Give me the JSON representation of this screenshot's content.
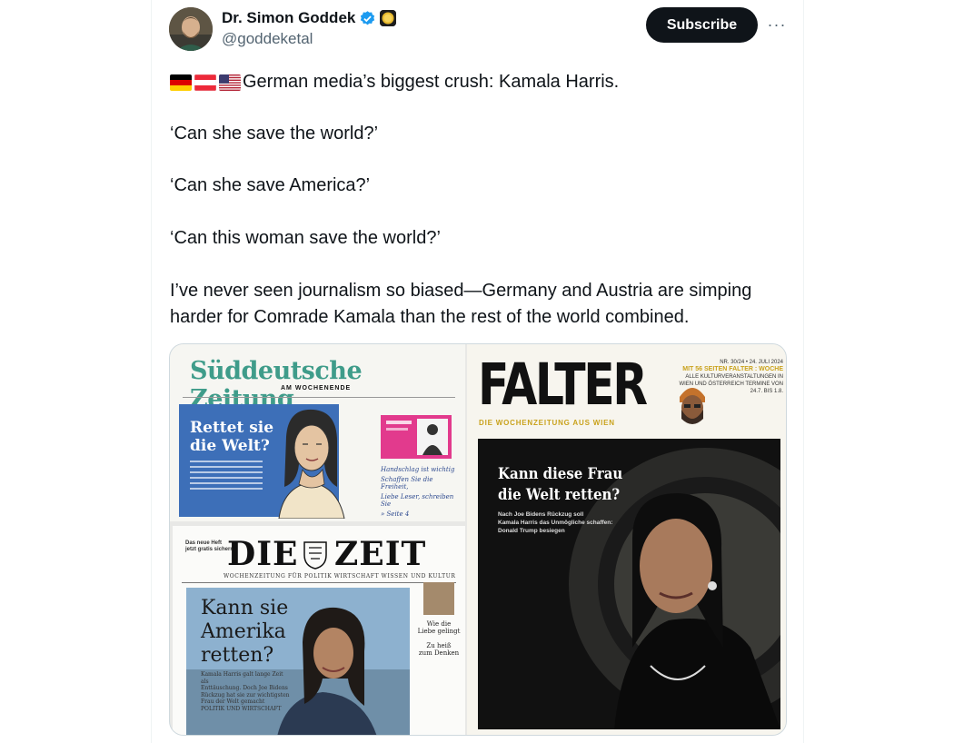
{
  "author": {
    "display_name": "Dr. Simon Goddek",
    "handle": "@goddeketal",
    "verified_icon": "verified-badge-icon",
    "affiliate_icon": "gold-circle-badge-icon"
  },
  "actions": {
    "subscribe_label": "Subscribe",
    "more_label": "···"
  },
  "tweet": {
    "flags": [
      "germany-flag-icon",
      "austria-flag-icon",
      "usa-flag-icon"
    ],
    "line1": "German media’s biggest crush: Kamala Harris.",
    "line2": "‘Can she save the world?’",
    "line3": "‘Can she save America?’",
    "line4": "‘Can this woman save the world?’",
    "line5a": "I’ve never seen journalism so biased—Germany and Austria are simping",
    "line5b": "harder for Comrade Kamala than the rest of the world combined."
  },
  "media": {
    "sz": {
      "title": "Süddeutsche Zeitung",
      "subtitle": "AM WOCHENENDE",
      "headline_1": "Rettet sie",
      "headline_2": "die Welt?",
      "note_1": "Handschlag ist wichtig",
      "note_2": "Schaffen Sie die Freiheit,",
      "note_3": "Liebe Leser, schreiben Sie",
      "note_4": "» Seite 4"
    },
    "falter": {
      "title": "FALTER",
      "subtitle": "DIE WOCHENZEITUNG AUS WIEN",
      "issue": "NR. 30/24 • 24. JULI 2024",
      "promo": "MIT 56 SEITEN FALTER : WOCHE",
      "promo_sub": "ALLE KULTURVERANSTALTUNGEN IN WIEN UND ÖSTERREICH TERMINE VON 24.7. BIS 1.8.",
      "headline_1": "Kann diese Frau",
      "headline_2": "die Welt retten?",
      "dek_1": "Nach Joe Bidens Rückzug soll",
      "dek_2": "Kamala Harris das Unmögliche schaffen:",
      "dek_3": "Donald Trump besiegen"
    },
    "zeit": {
      "logo_left": "DIE",
      "logo_right": "ZEIT",
      "subtitle": "WOCHENZEITUNG FÜR POLITIK WIRTSCHAFT WISSEN UND KULTUR",
      "top_note_1": "Das neue Heft",
      "top_note_2": "jetzt gratis sichern!",
      "headline_1": "Kann sie",
      "headline_2": "Amerika",
      "headline_3": "retten?",
      "body_1": "Kamala Harris galt lange Zeit als",
      "body_2": "Enttäuschung. Doch Joe Bidens",
      "body_3": "Rückzug hat sie zur wichtigsten",
      "body_4": "Frau der Welt gemacht",
      "body_5": "POLITIK UND WIRTSCHAFT",
      "side_1a": "Wie die",
      "side_1b": "Liebe gelingt",
      "side_2a": "Zu heiß",
      "side_2b": "zum Denken"
    }
  }
}
